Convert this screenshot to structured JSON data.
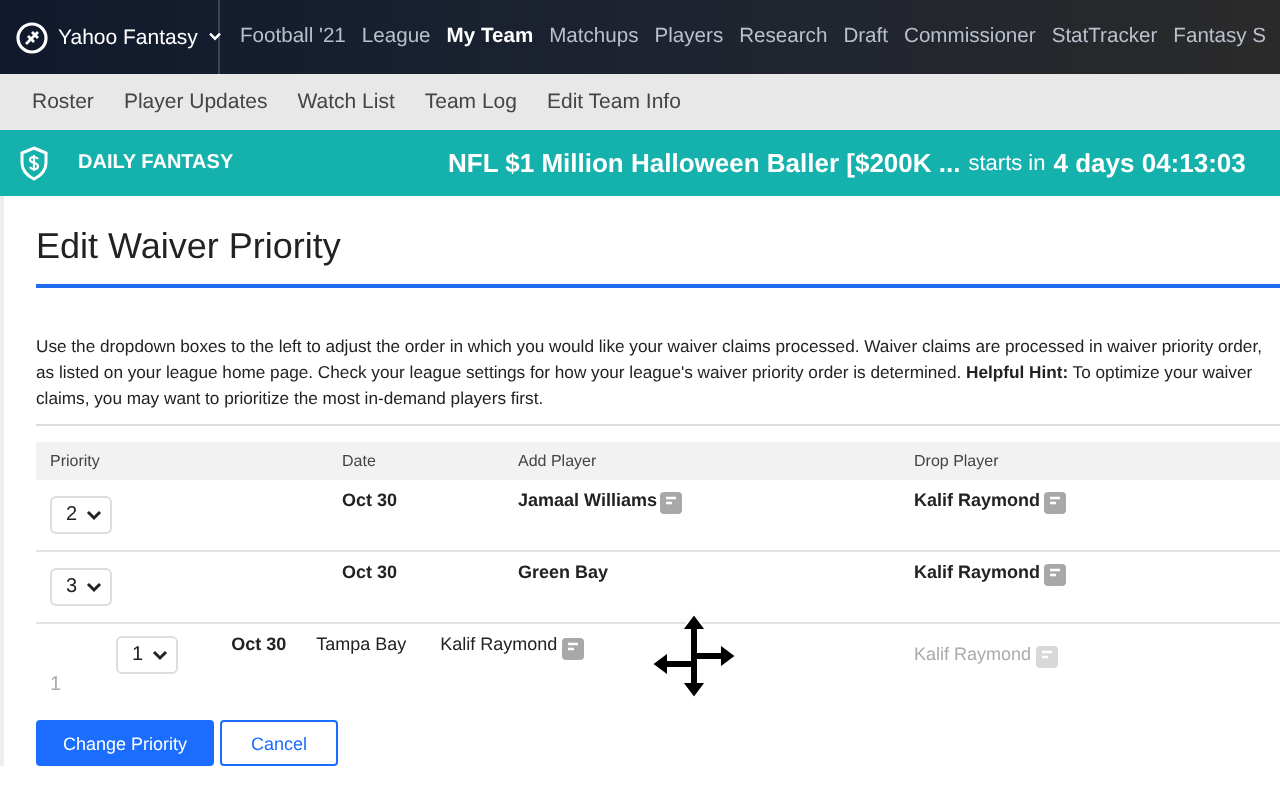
{
  "nav": {
    "brand": "Yahoo Fantasy",
    "items": [
      {
        "label": "Football '21",
        "selected": false
      },
      {
        "label": "League",
        "selected": false
      },
      {
        "label": "My Team",
        "selected": true
      },
      {
        "label": "Matchups",
        "selected": false
      },
      {
        "label": "Players",
        "selected": false
      },
      {
        "label": "Research",
        "selected": false
      },
      {
        "label": "Draft",
        "selected": false
      },
      {
        "label": "Commissioner",
        "selected": false
      },
      {
        "label": "StatTracker",
        "selected": false
      },
      {
        "label": "Fantasy S",
        "selected": false
      }
    ]
  },
  "subnav": [
    "Roster",
    "Player Updates",
    "Watch List",
    "Team Log",
    "Edit Team Info"
  ],
  "banner": {
    "brand": "DAILY FANTASY",
    "contest": "NFL $1 Million Halloween Baller [$200K ...",
    "starts": "starts in",
    "countdown": "4 days 04:13:03"
  },
  "title": "Edit Waiver Priority",
  "description": "Use the dropdown boxes to the left to adjust the order in which you would like your waiver claims processed. Waiver claims are processed in waiver priority order, as listed on your league home page. Check your league settings for how your league's waiver priority order is determined. **Helpful Hint:** To optimize your waiver claims, you may want to prioritize the most in-demand players first.",
  "table": {
    "columns": [
      "Priority",
      "Date",
      "Add Player",
      "Drop Player"
    ],
    "rows": [
      {
        "kind": "claim",
        "priority": "2",
        "date": "Oct 30",
        "add_player": "Jamaal Williams",
        "add_notes": true,
        "drop_player": "Kalif Raymond",
        "drop_notes": true
      },
      {
        "kind": "claim",
        "priority": "3",
        "date": "Oct 30",
        "add_player": "Green Bay",
        "add_notes": false,
        "drop_player": "Kalif Raymond",
        "drop_notes": true
      },
      {
        "kind": "placeholder",
        "priority": "1",
        "drop_player": "Kalif Raymond",
        "drop_notes": true
      }
    ],
    "dragged_row": {
      "priority": "1",
      "date": "Oct 30",
      "team": "Tampa Bay",
      "add_player": "Kalif Raymond",
      "add_notes": true
    }
  },
  "buttons": [
    {
      "label": "Change Priority",
      "kind": "primary"
    },
    {
      "label": "Cancel",
      "kind": "secondary"
    }
  ]
}
